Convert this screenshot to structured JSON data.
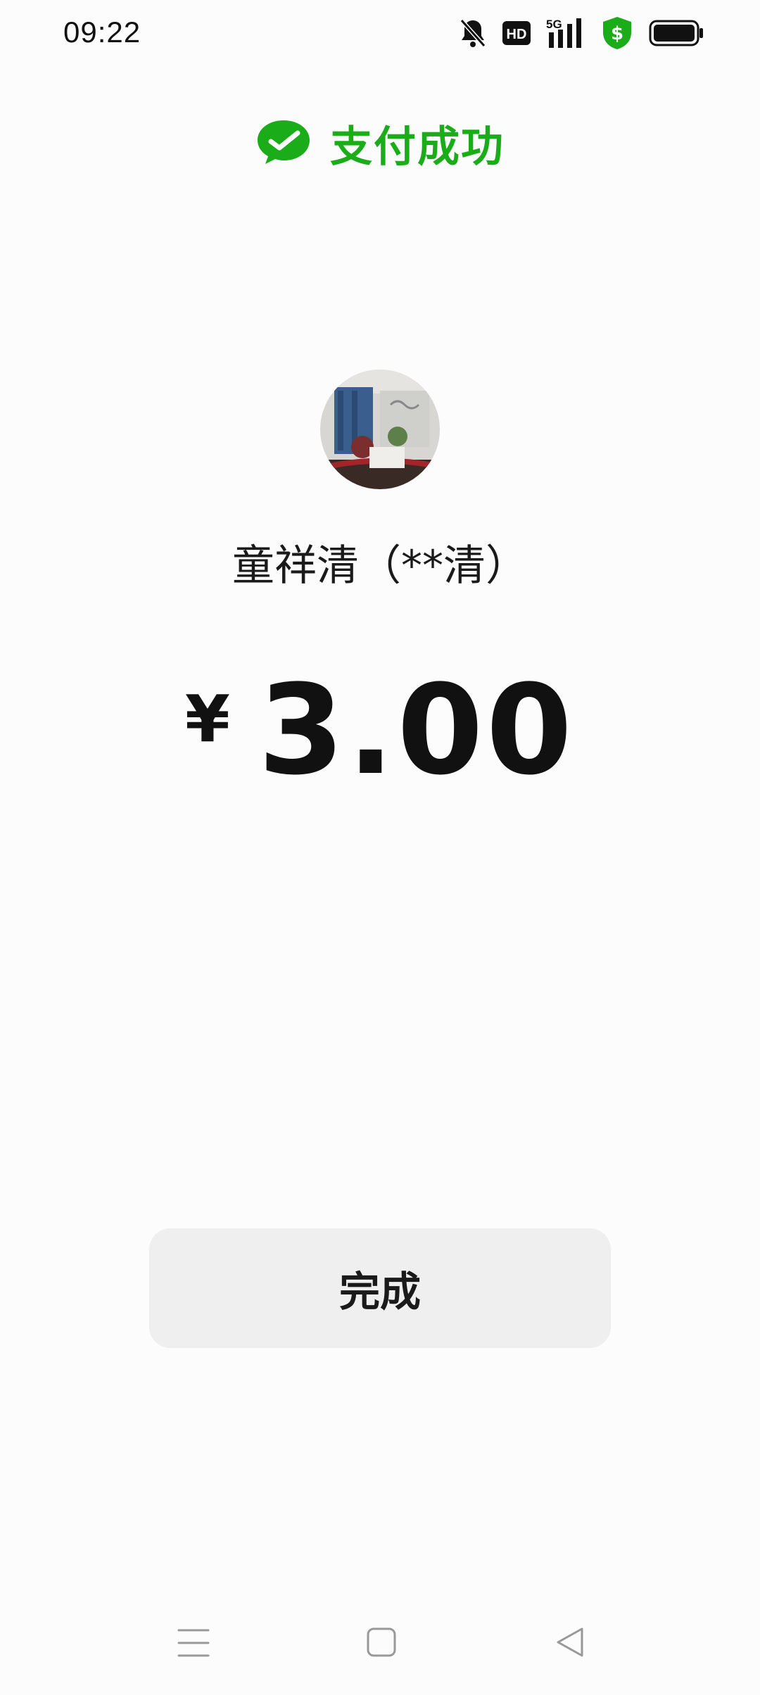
{
  "status_bar": {
    "time": "09:22",
    "icons": [
      "bell-muted-icon",
      "hd-icon",
      "5g-signal-icon",
      "shield-dollar-icon",
      "battery-icon"
    ],
    "hd_label": "HD",
    "network_label": "5G",
    "shield_symbol": "$"
  },
  "header": {
    "icon": "wechat-pay-check-icon",
    "title": "支付成功",
    "accent_color": "#1aad19"
  },
  "payee": {
    "name": "童祥清（**清）"
  },
  "amount": {
    "currency_symbol": "¥",
    "value": "3.00"
  },
  "actions": {
    "done_label": "完成"
  },
  "nav_bar": {
    "items": [
      "menu-icon",
      "home-icon",
      "back-icon"
    ]
  }
}
